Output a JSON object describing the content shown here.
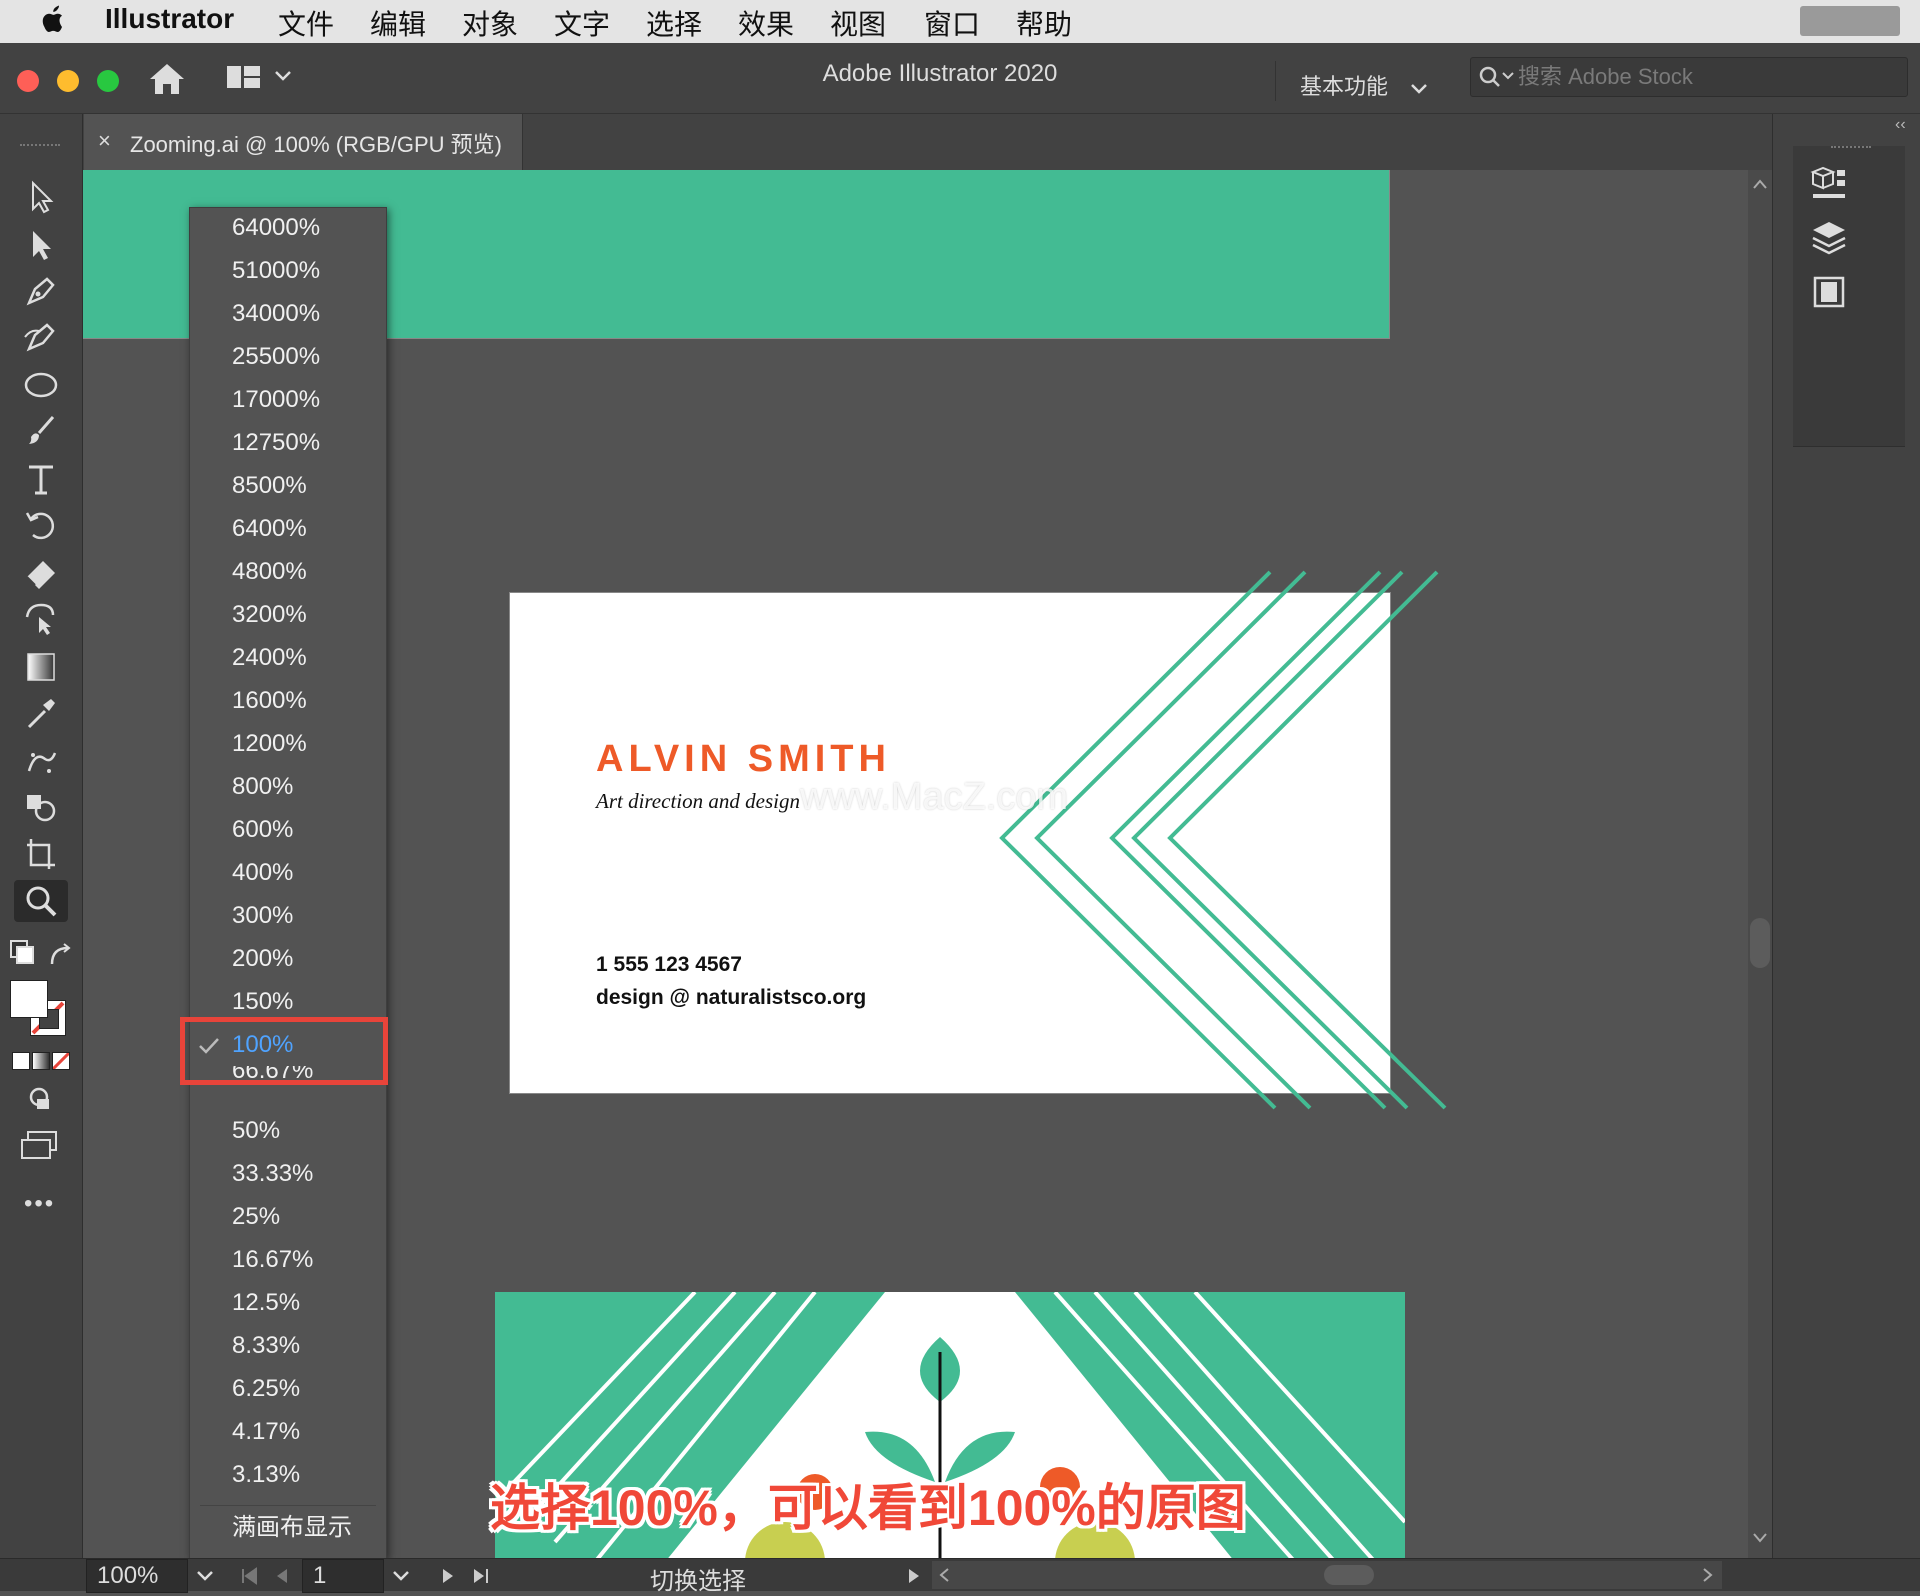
{
  "menubar": {
    "app": "Illustrator",
    "items": [
      "文件",
      "编辑",
      "对象",
      "文字",
      "选择",
      "效果",
      "视图",
      "窗口",
      "帮助"
    ]
  },
  "window": {
    "title": "Adobe Illustrator 2020",
    "workspace": "基本功能",
    "search_placeholder": "搜索 Adobe Stock"
  },
  "document_tab": {
    "close": "×",
    "title": "Zooming.ai @ 100% (RGB/GPU 预览)"
  },
  "zoom_menu": {
    "items": [
      "64000%",
      "51000%",
      "34000%",
      "25500%",
      "17000%",
      "12750%",
      "8500%",
      "6400%",
      "4800%",
      "3200%",
      "2400%",
      "1600%",
      "1200%",
      "800%",
      "600%",
      "400%",
      "300%",
      "200%",
      "150%",
      "100%",
      "66.67%",
      "50%",
      "33.33%",
      "25%",
      "16.67%",
      "12.5%",
      "8.33%",
      "6.25%",
      "4.17%",
      "3.13%"
    ],
    "selected": "100%",
    "fit_label": "满画布显示"
  },
  "card": {
    "name": "ALVIN SMITH",
    "tagline": "Art direction and design",
    "phone": "1 555 123 4567",
    "email": "design @ naturalistsco.org"
  },
  "watermark": "www.MacZ.com",
  "caption": "选择100%，可以看到100%的原图",
  "status": {
    "zoom": "100%",
    "artboard": "1",
    "mode": "切换选择"
  },
  "colors": {
    "accent_green": "#43bb93",
    "name_orange": "#ee5a28",
    "highlight_red": "#e8443a",
    "selected_blue": "#4fa3ff"
  }
}
